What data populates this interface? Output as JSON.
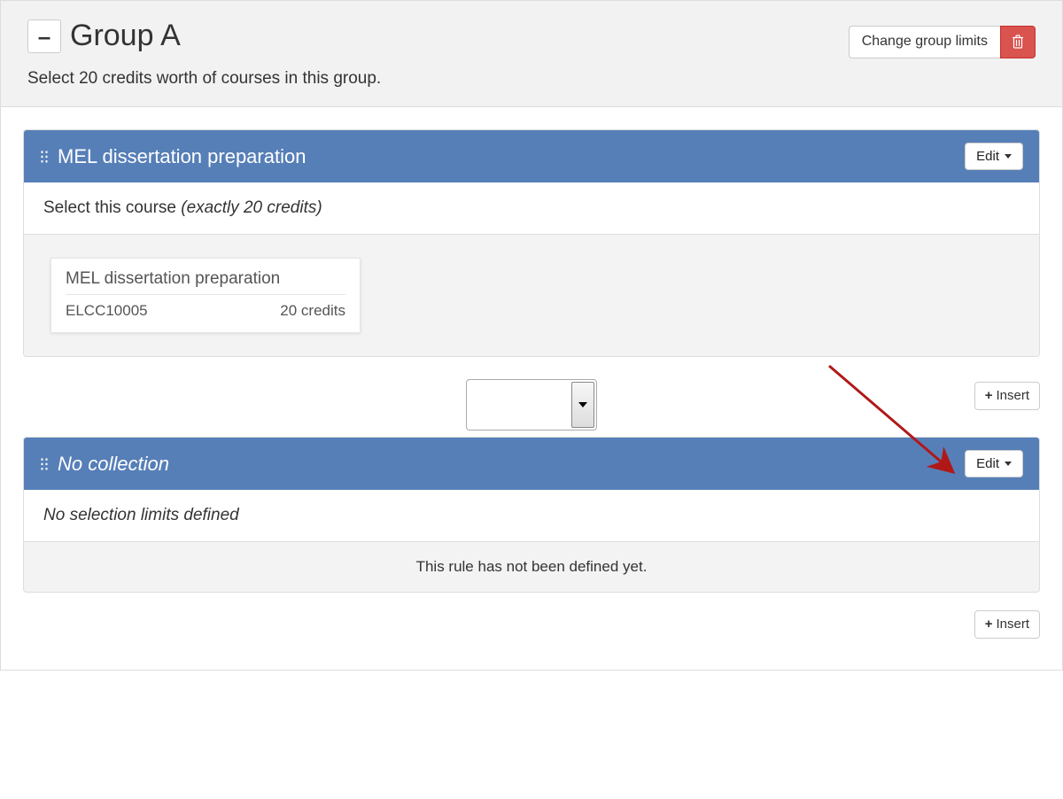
{
  "group": {
    "collapse_label": "–",
    "title": "Group A",
    "subtitle": "Select 20 credits worth of courses in this group.",
    "change_limits_label": "Change group limits"
  },
  "panel1": {
    "title": "MEL dissertation preparation",
    "edit_label": "Edit",
    "rule_prefix": "Select this course ",
    "rule_detail": "(exactly 20 credits)",
    "course": {
      "name": "MEL dissertation preparation",
      "code": "ELCC10005",
      "credits": "20 credits"
    }
  },
  "insert1": {
    "label": "Insert"
  },
  "panel2": {
    "title": "No collection",
    "edit_label": "Edit",
    "rule_text": "No selection limits defined",
    "empty_msg": "This rule has not been defined yet."
  },
  "insert2": {
    "label": "Insert"
  }
}
